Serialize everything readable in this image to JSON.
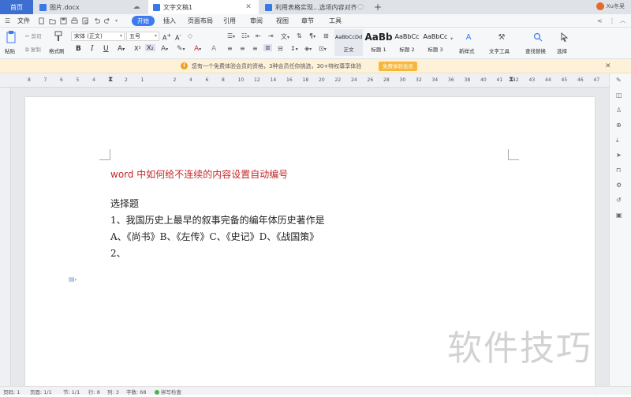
{
  "tabs": [
    {
      "label": "首页",
      "active": false
    },
    {
      "label": "图片.docx",
      "active": false
    },
    {
      "label": "文字文稿1",
      "active": true
    },
    {
      "label": "利用表格实现...选项内容对齐",
      "active": false
    }
  ],
  "user": {
    "name": "Xu冬吴"
  },
  "menu": {
    "file": "文件",
    "items": [
      "开始",
      "插入",
      "页面布局",
      "引用",
      "审阅",
      "视图",
      "章节",
      "工具"
    ]
  },
  "ribbon": {
    "paste": "粘贴",
    "cut": "剪切",
    "copy": "复制",
    "format_painter": "格式刷",
    "font_name": "宋体 (正文)",
    "font_size": "五号",
    "styles": [
      {
        "preview": "AaBbCcDd",
        "label": "正文"
      },
      {
        "preview": "AaBb",
        "label": "标题 1"
      },
      {
        "preview": "AaBbCc",
        "label": "标题 2"
      },
      {
        "preview": "AaBbCc",
        "label": "标题 3"
      }
    ],
    "new_style": "新样式",
    "text_tools": "文字工具",
    "find_replace": "查找替换",
    "select": "选择"
  },
  "notice": {
    "text": "您有一个免费体验会员的资格，3种会员任你挑选，30+特权尊享体验",
    "button": "免费体验会员"
  },
  "ruler": {
    "ticks": [
      "8",
      "7",
      "6",
      "5",
      "4",
      "3",
      "2",
      "1",
      "",
      "2",
      "4",
      "6",
      "8",
      "10",
      "12",
      "14",
      "16",
      "18",
      "20",
      "22",
      "24",
      "26",
      "28",
      "30",
      "32",
      "34",
      "36",
      "38",
      "40",
      "41",
      "42",
      "43",
      "44",
      "45",
      "46",
      "47"
    ]
  },
  "document": {
    "title": "word 中如何给不连续的内容设置自动编号",
    "lines": [
      "选择题",
      "1、我国历史上最早的叙事完备的编年体历史著作是",
      "A、《尚书》B、《左传》C、《史记》D、《战国策》",
      "2、"
    ]
  },
  "status": {
    "page_num": "页码: 1",
    "pages": "页面: 1/1",
    "section": "节: 1/1",
    "row": "行: 8",
    "col": "列: 3",
    "words": "字数: 68",
    "spell": "拼写检查"
  },
  "watermark": "软件技巧",
  "colors": {
    "accent": "#3d7af0",
    "title_red": "#c62828",
    "notice_bg": "#fdf2d9"
  }
}
